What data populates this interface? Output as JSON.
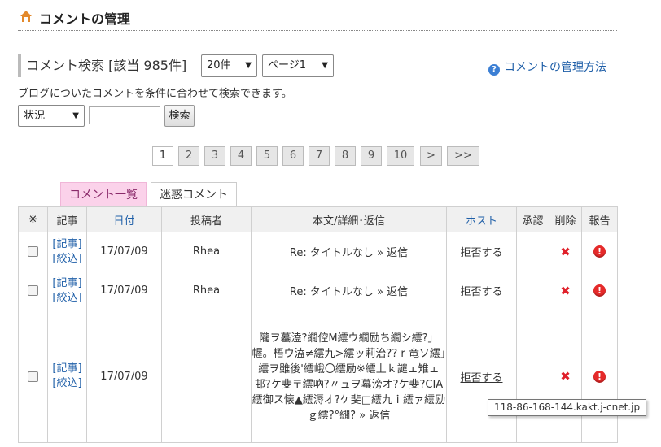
{
  "page": {
    "title": "コメントの管理"
  },
  "search": {
    "heading": "コメント検索 [該当 985件]",
    "per_page": "20件",
    "page_select": "ページ1",
    "help_link": "コメントの管理方法",
    "description": "ブログについたコメントを条件に合わせて検索できます。",
    "status_select": "状況",
    "keyword_value": "",
    "search_button": "検索"
  },
  "pager": {
    "current": "1",
    "pages": [
      "2",
      "3",
      "4",
      "5",
      "6",
      "7",
      "8",
      "9",
      "10"
    ],
    "next": ">",
    "last": ">>"
  },
  "tabs": {
    "list": "コメント一覧",
    "spam": "迷惑コメント"
  },
  "table": {
    "headers": {
      "check": "※",
      "article": "記事",
      "date": "日付",
      "author": "投稿者",
      "body": "本文/詳細･返信",
      "host": "ホスト",
      "approve": "承認",
      "delete": "削除",
      "report": "報告"
    },
    "rows": [
      {
        "article": "[記事]",
        "filter": "[絞込]",
        "date": "17/07/09",
        "author": "Rhea",
        "body": "Re: タイトルなし » 返信",
        "host": "拒否する"
      },
      {
        "article": "[記事]",
        "filter": "[絞込]",
        "date": "17/07/09",
        "author": "Rhea",
        "body": "Re: タイトルなし » 返信",
        "host": "拒否する"
      },
      {
        "article": "[記事]",
        "filter": "[絞込]",
        "date": "17/07/09",
        "author": "",
        "body": "隴ヲ蟇溘?繝倥M繧ウ繝励ち繝シ繧?」幄。梧ウ溘≠繧九>繧ッ莉治?? r 竜ソ繧」繧ヲ雖後'繧峨〇繧励※繧上ｋ譴ェ雉ェ邨?ケ斐〒繧吶?〃ュヲ蟇滂オ?ケ斐?CIA繧御ス懐▲繧溽オ?ケ斐□繧九ｉ繧ァ繧励ｇ繧?°繝? » 返信",
        "host": "拒否する"
      }
    ]
  },
  "tooltip": "118-86-168-144.kakt.j-cnet.jp",
  "colors": {
    "link": "#1f5fa8",
    "tab_active_bg": "#fbd2ea",
    "delete": "#e0202a",
    "report": "#e52a2a"
  },
  "icons": {
    "home": "home-icon",
    "help": "help-icon",
    "delete": "delete-x-icon",
    "report": "report-exclamation-icon"
  }
}
